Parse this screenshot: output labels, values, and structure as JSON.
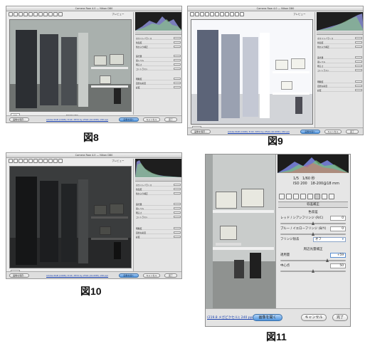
{
  "panels": [
    {
      "id": "fig8",
      "caption": "図8",
      "window_title": "Camera Raw 4.0 — Nikon D80",
      "preview_label": "プレビュー",
      "zoom": "20%",
      "meta": "NIKON D80",
      "link": "Adobe RGB (1998); 8 bit; 3872 by 2592 (10.0MP); 240 ppi",
      "buttons": [
        "画像を保存...",
        "画像を開く",
        "キャンセル",
        "完了"
      ],
      "brightness": "normal"
    },
    {
      "id": "fig9",
      "caption": "図9",
      "window_title": "Camera Raw 4.0 — Nikon D80",
      "preview_label": "プレビュー",
      "zoom": "20%",
      "meta": "NIKON D80",
      "link": "Adobe RGB (1998); 8 bit; 3872 by 2592 (10.0MP); 240 ppi",
      "buttons": [
        "画像を保存...",
        "画像を開く",
        "キャンセル",
        "完了"
      ],
      "brightness": "bright"
    },
    {
      "id": "fig10",
      "caption": "図10",
      "window_title": "Camera Raw 4.0 — Nikon D80",
      "preview_label": "プレビュー",
      "zoom": "20%",
      "meta": "NIKON D80",
      "link": "Adobe RGB (1998); 8 bit; 3872 by 2592 (10.0MP); 240 ppi",
      "buttons": [
        "画像を保存...",
        "画像を開く",
        "キャンセル",
        "完了"
      ],
      "brightness": "dark"
    }
  ],
  "fig11": {
    "caption": "図11",
    "shutter": "1/5",
    "shutter_unit": "1/60 秒",
    "iso": "ISO 200",
    "lens": "18-200@18 mm",
    "tab": "収差補正",
    "section1": "色収差",
    "fields": [
      {
        "label": "レッド / シアンフリンジ (R/C)",
        "value": "0"
      },
      {
        "label": "ブルー / イエローフリンジ (B/Y)",
        "value": "0"
      }
    ],
    "fringe_label": "フリンジ除去",
    "fringe_value": "オフ",
    "section2": "周辺光量補正",
    "amount_label": "適用量",
    "amount_value": "+59",
    "midpoint_label": "中心点",
    "midpoint_value": "50",
    "link": "(219.8 メガピクセル); 240 ppi",
    "open_btn": "画像を開く",
    "cancel_btn": "キャンセル",
    "done_btn": "完了"
  },
  "side_rows": [
    "ホワイトバランス",
    "色温度",
    "色かぶり補正",
    "露光量",
    "黒レベル",
    "明るさ",
    "コントラスト",
    "明瞭度",
    "自然な彩度",
    "彩度"
  ]
}
